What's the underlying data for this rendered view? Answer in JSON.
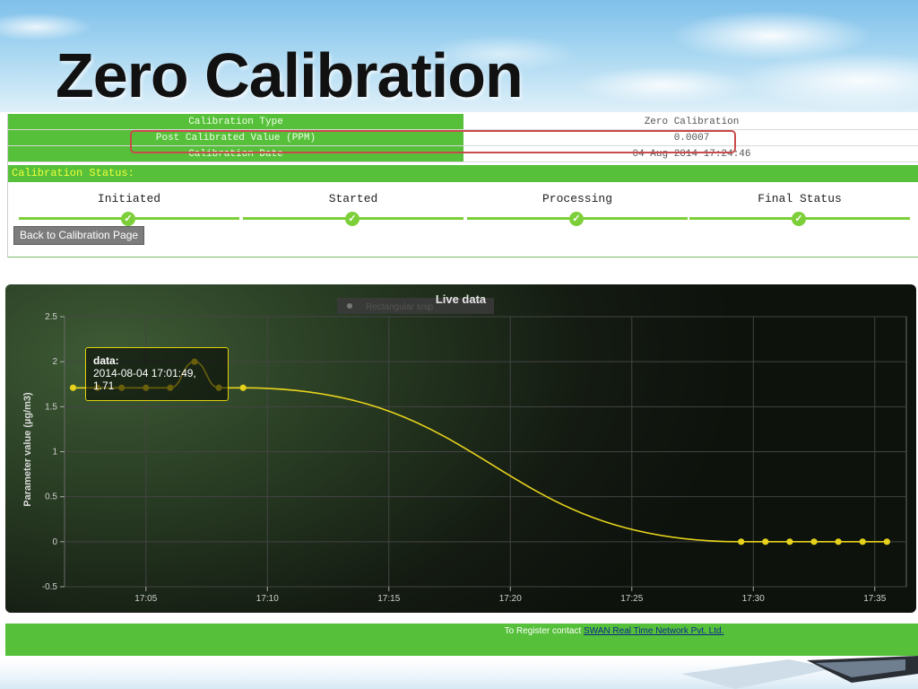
{
  "slide": {
    "title": "Zero Calibration"
  },
  "calibration": {
    "rows": [
      {
        "label": "Calibration Type",
        "value": "Zero Calibration"
      },
      {
        "label": "Post Calibrated Value (PPM)",
        "value": "0.0007"
      },
      {
        "label": "Calibration Date",
        "value": "04 Aug 2014 17:24:46"
      }
    ],
    "status_label": "Calibration Status:",
    "steps": [
      {
        "label": "Initiated",
        "done": true
      },
      {
        "label": "Started",
        "done": true
      },
      {
        "label": "Processing",
        "done": true
      },
      {
        "label": "Final Status",
        "done": true
      }
    ],
    "back_button": "Back to Calibration Page"
  },
  "chart_menu": {
    "label": "Rectangular snip"
  },
  "tooltip": {
    "series": "data:",
    "time": "2014-08-04 17:01:49,",
    "value": "1.71"
  },
  "chart_data": {
    "type": "line",
    "title": "Live data",
    "ylabel": "Parameter value (µg/m3)",
    "xlabel": "",
    "ylim": [
      -0.5,
      2.5
    ],
    "yticks": [
      "2.5",
      "2",
      "1.5",
      "1",
      "0.5",
      "0",
      "-0.5"
    ],
    "xticks": [
      "17:05",
      "17:10",
      "17:15",
      "17:20",
      "17:25",
      "17:30",
      "17:35"
    ],
    "xlim_minutes": [
      "17:02",
      "17:36"
    ],
    "grid": true,
    "line_color": "#e6d21c",
    "series": [
      {
        "name": "data",
        "points": [
          [
            "17:02",
            1.71
          ],
          [
            "17:03",
            1.71
          ],
          [
            "17:04",
            1.71
          ],
          [
            "17:05",
            1.71
          ],
          [
            "17:06",
            1.71
          ],
          [
            "17:07",
            2.0
          ],
          [
            "17:08",
            1.71
          ],
          [
            "17:09",
            1.71
          ],
          [
            "17:29.5",
            0
          ],
          [
            "17:30.5",
            0
          ],
          [
            "17:31.5",
            0
          ],
          [
            "17:32.5",
            0
          ],
          [
            "17:33.5",
            0
          ],
          [
            "17:34.5",
            0
          ],
          [
            "17:35.5",
            0
          ]
        ]
      }
    ]
  },
  "footer": {
    "text": "To Register contact ",
    "link": "SWAN Real Time Network Pvt. Ltd."
  }
}
